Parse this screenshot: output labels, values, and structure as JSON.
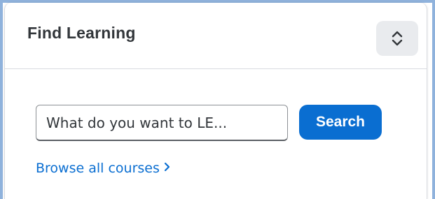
{
  "panel": {
    "title": "Find Learning",
    "toggle_icon": "expand-collapse-icon"
  },
  "search": {
    "value": "What do you want to LE...",
    "button_label": "Search"
  },
  "browse": {
    "link_label": "Browse all courses",
    "chevron_icon": "chevron-right-icon"
  },
  "colors": {
    "accent": "#0a6ed1",
    "title_text": "#32363a",
    "frame_border": "#8fb2dc",
    "toggle_bg": "#e9ebee"
  }
}
